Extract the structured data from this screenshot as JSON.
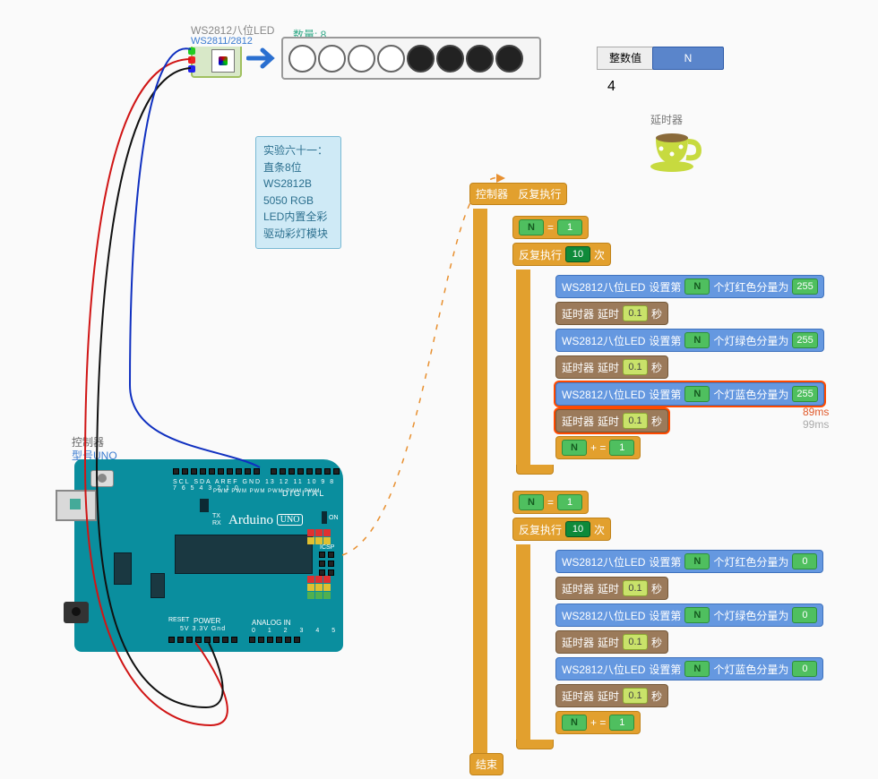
{
  "led_module": {
    "title": "WS2812八位LED",
    "subtitle": "WS2811/2812",
    "count_label": "数量: 8",
    "led_states": [
      "on",
      "on",
      "on",
      "on",
      "off",
      "off",
      "off",
      "off"
    ]
  },
  "int_var": {
    "label": "整数值",
    "name": "N",
    "value": "4"
  },
  "timer_comp": {
    "label": "延时器"
  },
  "comment": "实验六十一： 直条8位WS2812B 5050 RGB LED内置全彩驱动彩灯模块",
  "controller": {
    "label": "控制器",
    "model_prefix": "型号",
    "model": "UNO",
    "board_name": "Arduino",
    "board_model": "UNO",
    "digital_lbl": "DIGITAL",
    "analog_lbl": "ANALOG IN",
    "power_lbl": "POWER",
    "on_lbl": "ON",
    "tx": "TX",
    "rx": "RX",
    "icsp": "ICSP",
    "reset": "RESET",
    "p5v": "5V 3.3V Gnd",
    "scl": "SCL",
    "sda": "SDA",
    "aref": "AREF",
    "gnd": "GND",
    "dpins": "13 12 11 10 9 8  7 6 5 4 3 2 1 0",
    "apins": "0 1 2 3 4 5",
    "pwm": "PWM  PWM PWM PWM    PWM PWM"
  },
  "blocks": {
    "header_ctrl": "控制器",
    "header_loop": "反复执行",
    "assign_op": "=",
    "inc_op": "+ =",
    "loop_prefix": "反复执行",
    "loop_count": "10",
    "loop_suffix": "次",
    "ws_prefix": "WS2812八位LED",
    "ws_set": "设置第",
    "ws_n": "N",
    "red": "个灯红色分量为",
    "green": "个灯绿色分量为",
    "blue": "个灯蓝色分量为",
    "delay_comp": "延时器",
    "delay_word": "延时",
    "delay_val": "0.1",
    "delay_unit": "秒",
    "v255": "255",
    "v0": "0",
    "v1": "1",
    "tip1": "89ms",
    "tip2": "99ms",
    "end": "结束"
  }
}
